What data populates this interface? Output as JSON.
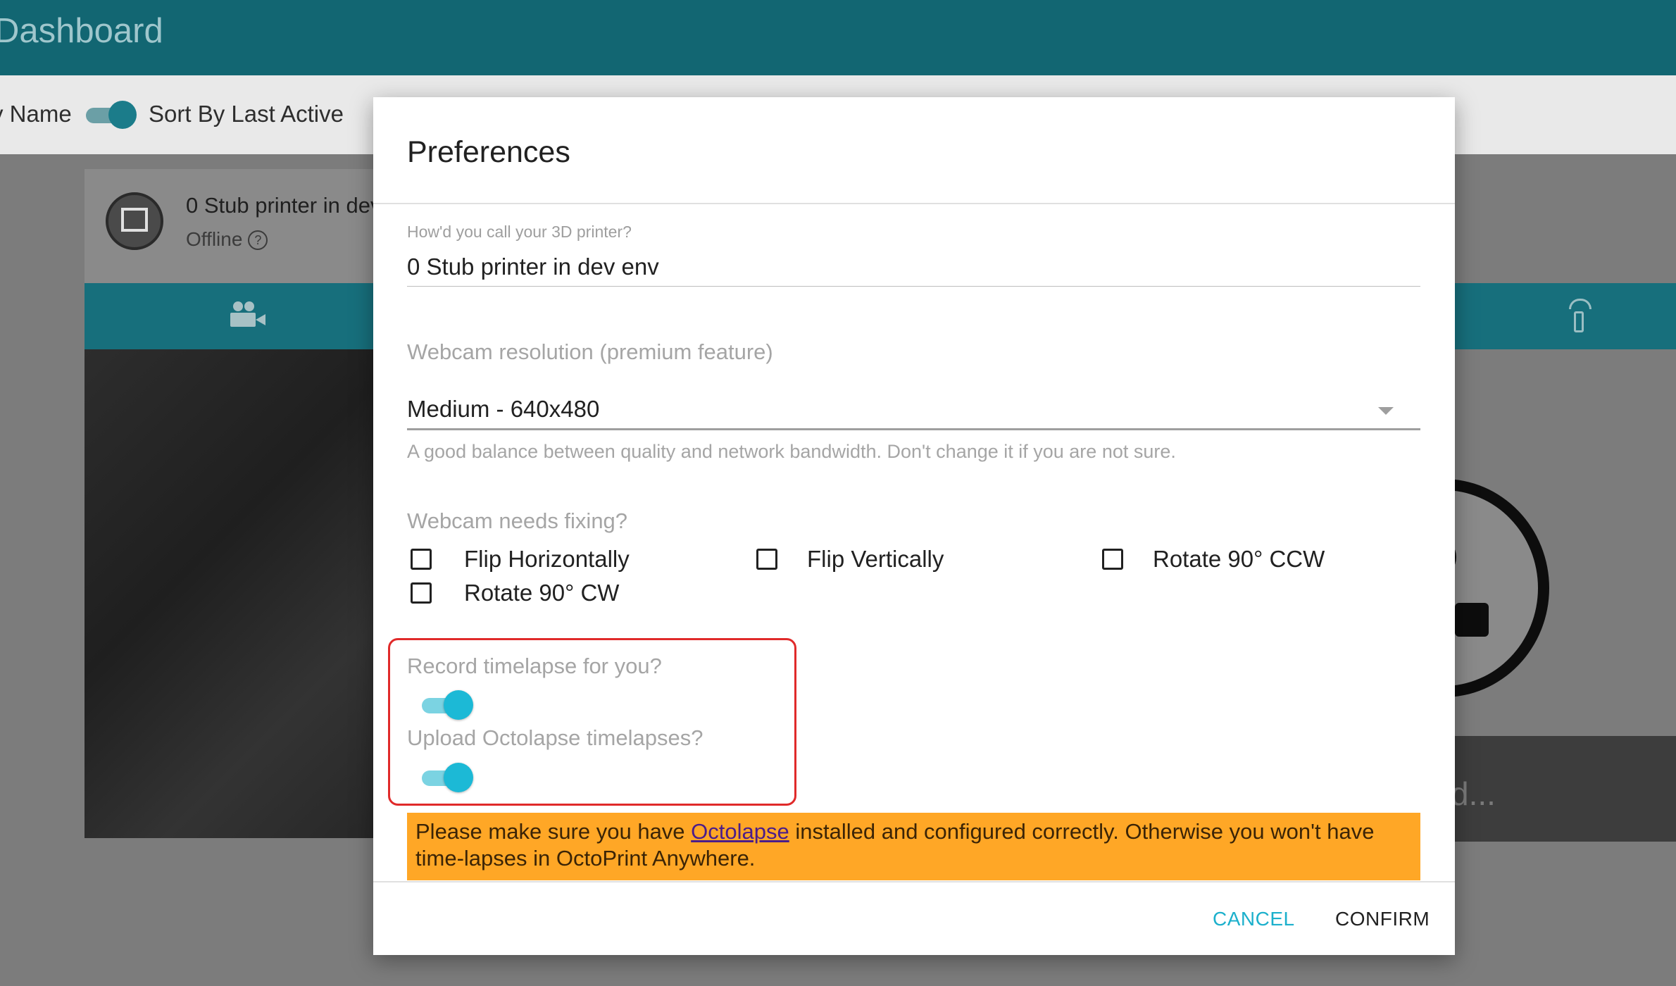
{
  "app": {
    "header_title": "Dashboard",
    "sort_by_name_label": "y Name",
    "sort_by_last_active_label": "Sort By Last Active",
    "printer_card": {
      "name": "0 Stub printer in dev",
      "status": "Offline",
      "status_help_icon": "?"
    },
    "background_status_text": "d..."
  },
  "dialog": {
    "title": "Preferences",
    "printer_name": {
      "label": "How'd you call your 3D printer?",
      "value": "0 Stub printer in dev env"
    },
    "webcam_resolution": {
      "label": "Webcam resolution (premium feature)",
      "selected": "Medium - 640x480",
      "hint": "A good balance between quality and network bandwidth. Don't change it if you are not sure."
    },
    "webcam_fixing": {
      "label": "Webcam needs fixing?",
      "options": [
        {
          "label": "Flip Horizontally",
          "checked": false
        },
        {
          "label": "Flip Vertically",
          "checked": false
        },
        {
          "label": "Rotate 90° CCW",
          "checked": false
        },
        {
          "label": "Rotate 90° CW",
          "checked": false
        }
      ]
    },
    "timelapse": {
      "record_label": "Record timelapse for you?",
      "record_enabled": true,
      "upload_octolapse_label": "Upload Octolapse timelapses?",
      "upload_octolapse_enabled": true
    },
    "warning": {
      "text_before": "Please make sure you have ",
      "link_text": "Octolapse",
      "text_after": " installed and configured correctly. Otherwise you won't have time-lapses in OctoPrint Anywhere."
    },
    "buttons": {
      "cancel": "CANCEL",
      "confirm": "CONFIRM"
    }
  },
  "colors": {
    "header": "#126672",
    "toggle_accent": "#1cb9d6",
    "warning_bg": "#ffa726",
    "highlight_border": "#e02a2a",
    "cancel_text": "#1cb0cc"
  }
}
